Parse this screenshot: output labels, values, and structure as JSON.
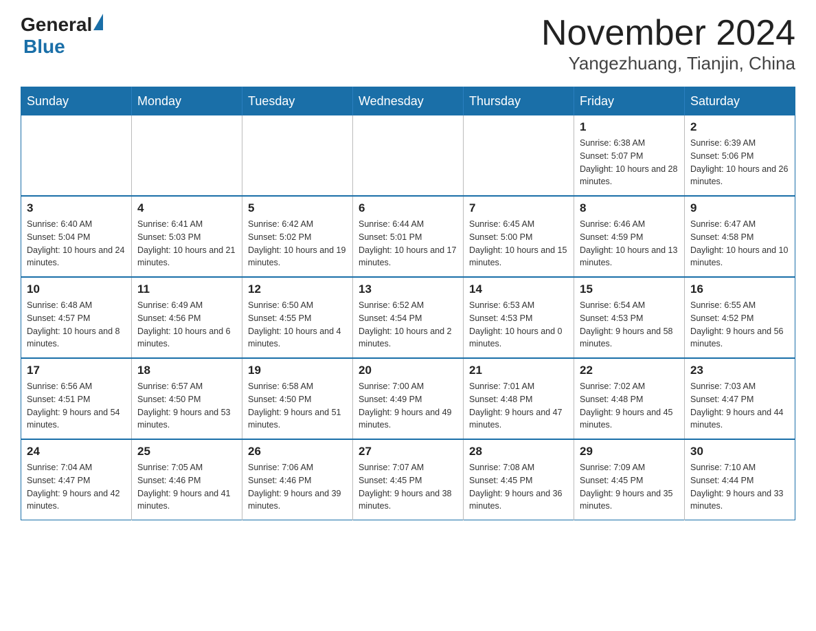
{
  "header": {
    "logo_general": "General",
    "logo_blue": "Blue",
    "month": "November 2024",
    "location": "Yangezhuang, Tianjin, China"
  },
  "weekdays": [
    "Sunday",
    "Monday",
    "Tuesday",
    "Wednesday",
    "Thursday",
    "Friday",
    "Saturday"
  ],
  "weeks": [
    [
      {
        "day": "",
        "info": ""
      },
      {
        "day": "",
        "info": ""
      },
      {
        "day": "",
        "info": ""
      },
      {
        "day": "",
        "info": ""
      },
      {
        "day": "",
        "info": ""
      },
      {
        "day": "1",
        "info": "Sunrise: 6:38 AM\nSunset: 5:07 PM\nDaylight: 10 hours and 28 minutes."
      },
      {
        "day": "2",
        "info": "Sunrise: 6:39 AM\nSunset: 5:06 PM\nDaylight: 10 hours and 26 minutes."
      }
    ],
    [
      {
        "day": "3",
        "info": "Sunrise: 6:40 AM\nSunset: 5:04 PM\nDaylight: 10 hours and 24 minutes."
      },
      {
        "day": "4",
        "info": "Sunrise: 6:41 AM\nSunset: 5:03 PM\nDaylight: 10 hours and 21 minutes."
      },
      {
        "day": "5",
        "info": "Sunrise: 6:42 AM\nSunset: 5:02 PM\nDaylight: 10 hours and 19 minutes."
      },
      {
        "day": "6",
        "info": "Sunrise: 6:44 AM\nSunset: 5:01 PM\nDaylight: 10 hours and 17 minutes."
      },
      {
        "day": "7",
        "info": "Sunrise: 6:45 AM\nSunset: 5:00 PM\nDaylight: 10 hours and 15 minutes."
      },
      {
        "day": "8",
        "info": "Sunrise: 6:46 AM\nSunset: 4:59 PM\nDaylight: 10 hours and 13 minutes."
      },
      {
        "day": "9",
        "info": "Sunrise: 6:47 AM\nSunset: 4:58 PM\nDaylight: 10 hours and 10 minutes."
      }
    ],
    [
      {
        "day": "10",
        "info": "Sunrise: 6:48 AM\nSunset: 4:57 PM\nDaylight: 10 hours and 8 minutes."
      },
      {
        "day": "11",
        "info": "Sunrise: 6:49 AM\nSunset: 4:56 PM\nDaylight: 10 hours and 6 minutes."
      },
      {
        "day": "12",
        "info": "Sunrise: 6:50 AM\nSunset: 4:55 PM\nDaylight: 10 hours and 4 minutes."
      },
      {
        "day": "13",
        "info": "Sunrise: 6:52 AM\nSunset: 4:54 PM\nDaylight: 10 hours and 2 minutes."
      },
      {
        "day": "14",
        "info": "Sunrise: 6:53 AM\nSunset: 4:53 PM\nDaylight: 10 hours and 0 minutes."
      },
      {
        "day": "15",
        "info": "Sunrise: 6:54 AM\nSunset: 4:53 PM\nDaylight: 9 hours and 58 minutes."
      },
      {
        "day": "16",
        "info": "Sunrise: 6:55 AM\nSunset: 4:52 PM\nDaylight: 9 hours and 56 minutes."
      }
    ],
    [
      {
        "day": "17",
        "info": "Sunrise: 6:56 AM\nSunset: 4:51 PM\nDaylight: 9 hours and 54 minutes."
      },
      {
        "day": "18",
        "info": "Sunrise: 6:57 AM\nSunset: 4:50 PM\nDaylight: 9 hours and 53 minutes."
      },
      {
        "day": "19",
        "info": "Sunrise: 6:58 AM\nSunset: 4:50 PM\nDaylight: 9 hours and 51 minutes."
      },
      {
        "day": "20",
        "info": "Sunrise: 7:00 AM\nSunset: 4:49 PM\nDaylight: 9 hours and 49 minutes."
      },
      {
        "day": "21",
        "info": "Sunrise: 7:01 AM\nSunset: 4:48 PM\nDaylight: 9 hours and 47 minutes."
      },
      {
        "day": "22",
        "info": "Sunrise: 7:02 AM\nSunset: 4:48 PM\nDaylight: 9 hours and 45 minutes."
      },
      {
        "day": "23",
        "info": "Sunrise: 7:03 AM\nSunset: 4:47 PM\nDaylight: 9 hours and 44 minutes."
      }
    ],
    [
      {
        "day": "24",
        "info": "Sunrise: 7:04 AM\nSunset: 4:47 PM\nDaylight: 9 hours and 42 minutes."
      },
      {
        "day": "25",
        "info": "Sunrise: 7:05 AM\nSunset: 4:46 PM\nDaylight: 9 hours and 41 minutes."
      },
      {
        "day": "26",
        "info": "Sunrise: 7:06 AM\nSunset: 4:46 PM\nDaylight: 9 hours and 39 minutes."
      },
      {
        "day": "27",
        "info": "Sunrise: 7:07 AM\nSunset: 4:45 PM\nDaylight: 9 hours and 38 minutes."
      },
      {
        "day": "28",
        "info": "Sunrise: 7:08 AM\nSunset: 4:45 PM\nDaylight: 9 hours and 36 minutes."
      },
      {
        "day": "29",
        "info": "Sunrise: 7:09 AM\nSunset: 4:45 PM\nDaylight: 9 hours and 35 minutes."
      },
      {
        "day": "30",
        "info": "Sunrise: 7:10 AM\nSunset: 4:44 PM\nDaylight: 9 hours and 33 minutes."
      }
    ]
  ]
}
